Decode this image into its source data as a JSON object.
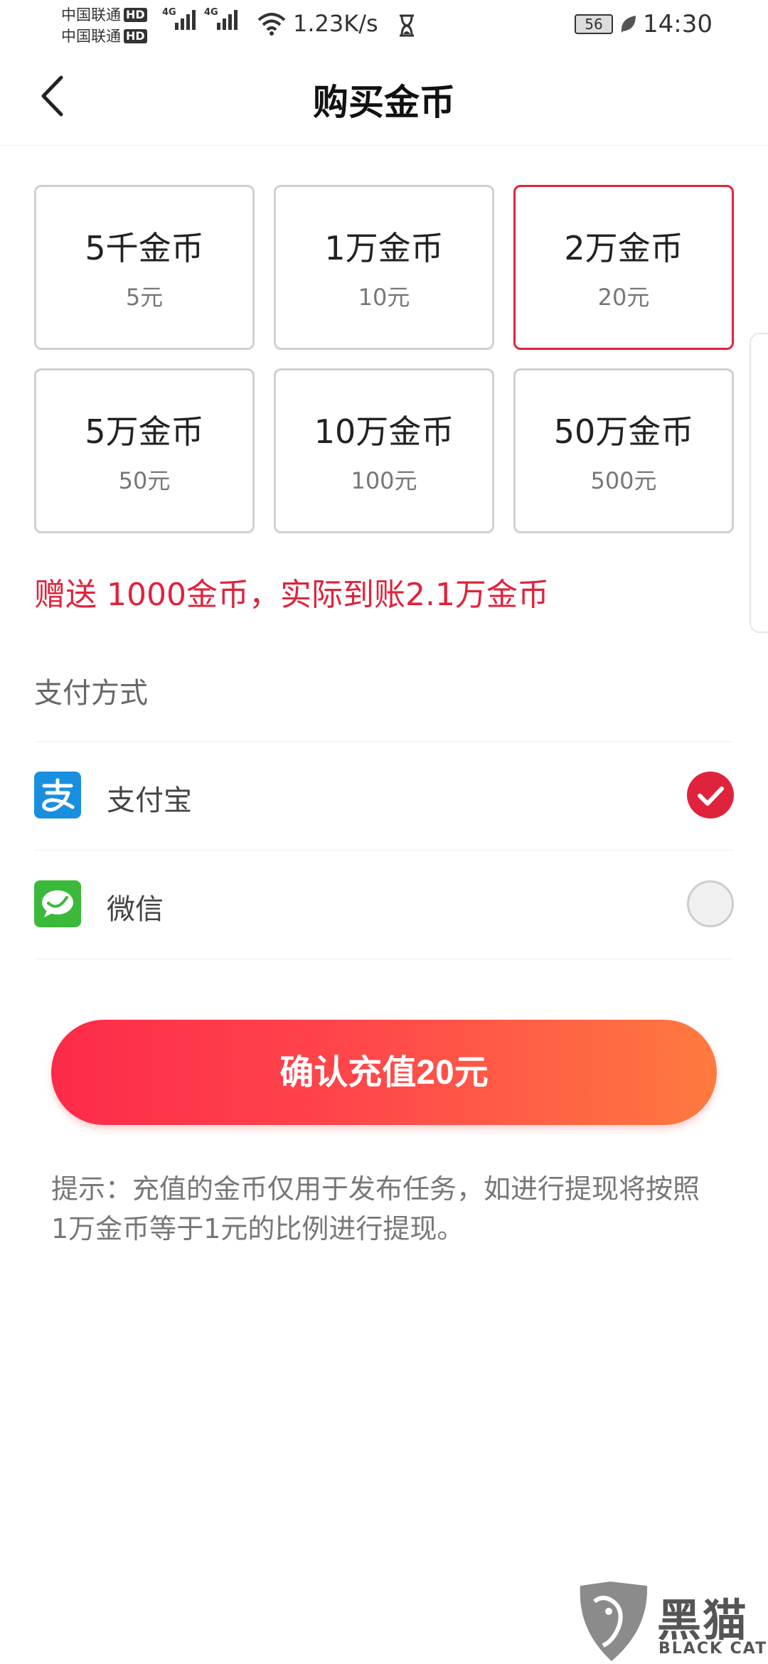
{
  "status_bar": {
    "carrier_1": "中国联通",
    "carrier_2": "中国联通",
    "hd_badge": "HD",
    "network_tag": "4G",
    "net_speed": "1.23K/s",
    "battery": "56",
    "time": "14:30"
  },
  "header": {
    "title": "购买金币"
  },
  "packages": [
    {
      "coins": "5千金币",
      "price": "5元",
      "selected": false
    },
    {
      "coins": "1万金币",
      "price": "10元",
      "selected": false
    },
    {
      "coins": "2万金币",
      "price": "20元",
      "selected": true
    },
    {
      "coins": "5万金币",
      "price": "50元",
      "selected": false
    },
    {
      "coins": "10万金币",
      "price": "100元",
      "selected": false
    },
    {
      "coins": "50万金币",
      "price": "500元",
      "selected": false
    }
  ],
  "bonus_text": "赠送 1000金币，实际到账2.1万金币",
  "payment": {
    "section_title": "支付方式",
    "methods": [
      {
        "label": "支付宝",
        "icon": "alipay-icon",
        "checked": true
      },
      {
        "label": "微信",
        "icon": "wechat-icon",
        "checked": false
      }
    ]
  },
  "confirm_button": "确认充值20元",
  "tip": "提示：充值的金币仅用于发布任务，如进行提现将按照 1万金币等于1元的比例进行提现。",
  "watermark": {
    "cn": "黑猫",
    "en": "BLACK CAT"
  },
  "colors": {
    "accent": "#e0233c",
    "button_gradient_start": "#fd2a4a",
    "button_gradient_end": "#ff7a3f",
    "alipay": "#1a8fe0",
    "wechat": "#3bb93b"
  }
}
